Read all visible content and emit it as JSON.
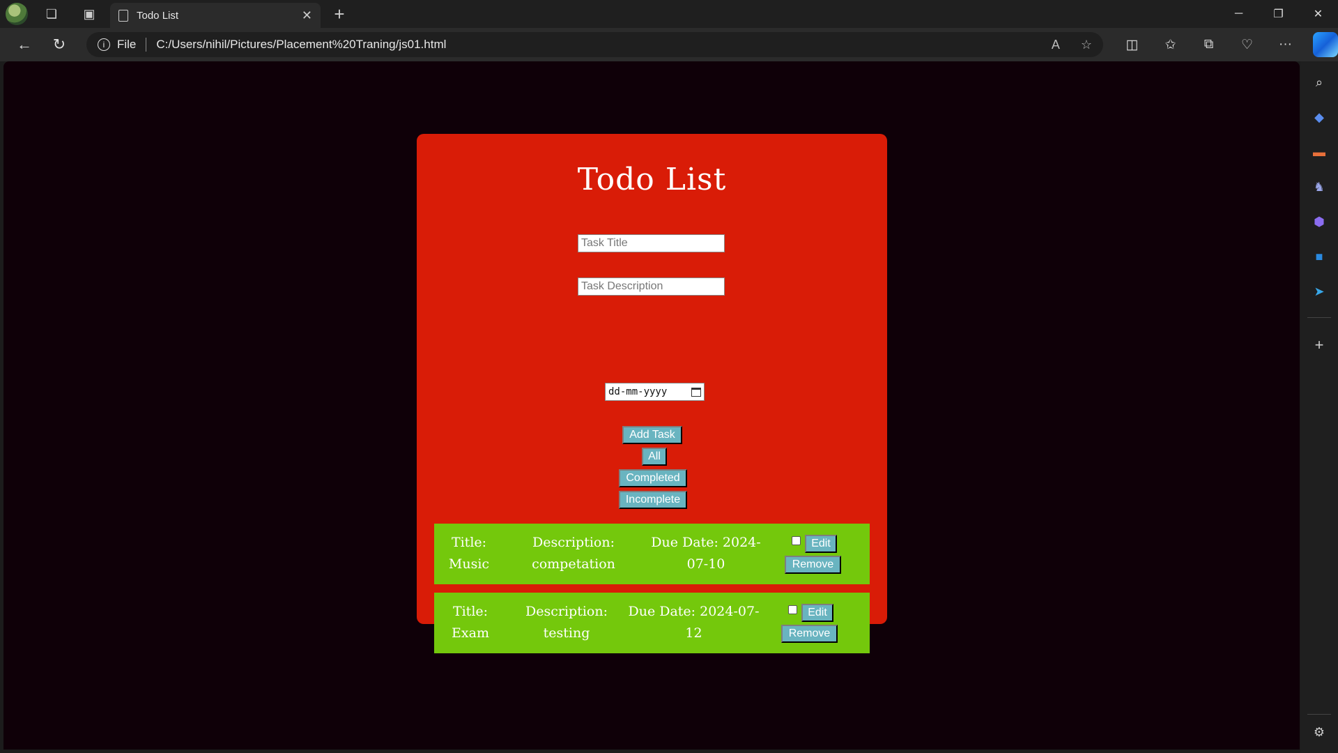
{
  "browser": {
    "tab_title": "Todo List",
    "tab_close": "✕",
    "new_tab": "+",
    "window_controls": [
      "─",
      "❐",
      "✕"
    ],
    "address": {
      "scheme_label": "File",
      "url": "C:/Users/nihil/Pictures/Placement%20Traning/js01.html"
    },
    "icons": [
      "back-icon",
      "refresh-icon",
      "read-aloud-icon",
      "favorite-star-icon",
      "split-screen-icon",
      "favorites-icon",
      "collections-icon",
      "browser-essentials-icon",
      "more-icon",
      "copilot-icon"
    ],
    "sidebar_icons": [
      "search-icon",
      "tag-icon",
      "toolbox-icon",
      "games-icon",
      "m365-icon",
      "outlook-icon",
      "send-icon",
      "add-icon",
      "settings-icon"
    ]
  },
  "app": {
    "title": "Todo List",
    "title_input": {
      "placeholder": "Task Title",
      "value": ""
    },
    "description_input": {
      "placeholder": "Task Description",
      "value": ""
    },
    "date_input": {
      "placeholder": "dd-mm-yyyy"
    },
    "buttons": {
      "add": "Add Task",
      "all": "All",
      "completed": "Completed",
      "incomplete": "Incomplete"
    },
    "tasks": [
      {
        "title_label": "Title:",
        "title": "Music",
        "description_label": "Description:",
        "description": "competation",
        "due_line1": "Due Date: 2024-",
        "due_line2": "07-10",
        "completed": false,
        "edit_label": "Edit",
        "remove_label": "Remove"
      },
      {
        "title_label": "Title:",
        "title": "Exam",
        "description_label": "Description:",
        "description": "testing",
        "due_line1": "Due Date: 2024-07-",
        "due_line2": "12",
        "completed": false,
        "edit_label": "Edit",
        "remove_label": "Remove"
      }
    ]
  },
  "colors": {
    "page_background": "#0f0008",
    "card_background": "#d91c07",
    "task_background": "#74c80c",
    "button_background": "#69b4c0"
  }
}
